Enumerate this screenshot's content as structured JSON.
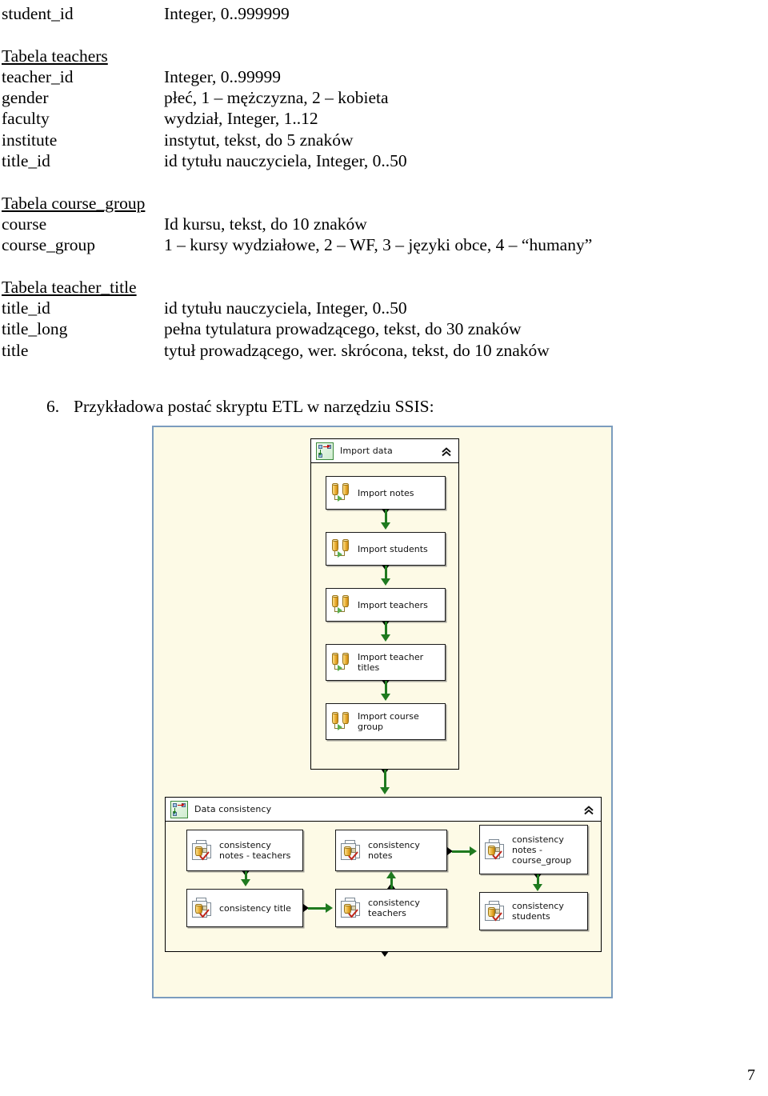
{
  "document": {
    "lead_row": {
      "name": "student_id",
      "desc": "Integer, 0..999999"
    },
    "tables": [
      {
        "heading": "Tabela teachers",
        "rows": [
          {
            "name": "teacher_id",
            "desc": "Integer, 0..99999"
          },
          {
            "name": "gender",
            "desc": "płeć, 1 – mężczyzna, 2 – kobieta"
          },
          {
            "name": "faculty",
            "desc": "wydział, Integer, 1..12"
          },
          {
            "name": "institute",
            "desc": "instytut, tekst, do 5 znaków"
          },
          {
            "name": "title_id",
            "desc": "id tytułu nauczyciela, Integer, 0..50"
          }
        ]
      },
      {
        "heading": "Tabela course_group",
        "rows": [
          {
            "name": "course",
            "desc": "Id kursu, tekst, do 10 znaków"
          },
          {
            "name": "course_group",
            "desc": "1 – kursy wydziałowe, 2 – WF, 3 – języki obce, 4 – “humany”"
          }
        ]
      },
      {
        "heading": "Tabela teacher_title",
        "rows": [
          {
            "name": "title_id",
            "desc": "id tytułu nauczyciela, Integer, 0..50"
          },
          {
            "name": "title_long",
            "desc": "pełna tytulatura prowadzącego, tekst, do 30 znaków"
          },
          {
            "name": "title",
            "desc": "tytuł prowadzącego, wer. skrócona, tekst, do 10 znaków"
          }
        ]
      }
    ],
    "numbered_item": {
      "number": "6.",
      "text": "Przykładowa postać skryptu ETL w narzędziu SSIS:"
    },
    "page_number": "7"
  },
  "screenshot": {
    "colors": {
      "canvas_background": "#fdfae6",
      "canvas_border": "#7b9cbe",
      "connector_green": "#1f7a1f",
      "container_header": "#ffffff",
      "task_background": "#ffffff"
    },
    "containers": [
      {
        "id": "import-data",
        "title": "Import data",
        "collapse_icon": "chevron-double-up-icon",
        "container_icon": "sequence-container-icon",
        "tasks": [
          {
            "id": "import-notes",
            "label": "Import notes",
            "icon": "data-flow-task-icon"
          },
          {
            "id": "import-students",
            "label": "Import students",
            "icon": "data-flow-task-icon"
          },
          {
            "id": "import-teachers",
            "label": "Import teachers",
            "icon": "data-flow-task-icon"
          },
          {
            "id": "import-teacher-titles",
            "label": "Import teacher\ntitles",
            "icon": "data-flow-task-icon"
          },
          {
            "id": "import-course-group",
            "label": "Import course\ngroup",
            "icon": "data-flow-task-icon"
          }
        ]
      },
      {
        "id": "data-consistency",
        "title": "Data consistency",
        "collapse_icon": "chevron-double-up-icon",
        "container_icon": "sequence-container-icon",
        "tasks": [
          {
            "id": "consistency-notes-teachers",
            "label": "consistency\nnotes - teachers",
            "icon": "sql-task-icon"
          },
          {
            "id": "consistency-notes",
            "label": "consistency\nnotes",
            "icon": "sql-task-icon"
          },
          {
            "id": "consistency-notes-course-group",
            "label": "consistency\nnotes -\ncourse_group",
            "icon": "sql-task-icon"
          },
          {
            "id": "consistency-title",
            "label": "consistency title",
            "icon": "sql-task-icon"
          },
          {
            "id": "consistency-teachers",
            "label": "consistency\nteachers",
            "icon": "sql-task-icon"
          },
          {
            "id": "consistency-students",
            "label": "consistency\nstudents",
            "icon": "sql-task-icon"
          }
        ]
      }
    ]
  }
}
